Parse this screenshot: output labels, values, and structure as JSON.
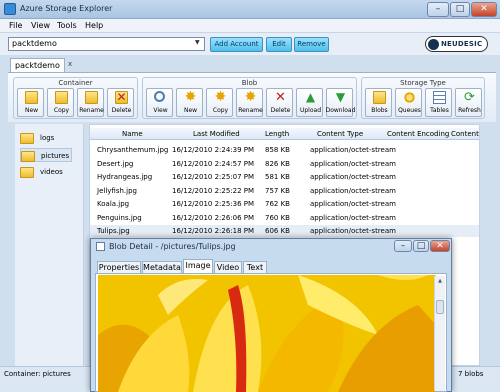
{
  "window": {
    "title": "Azure Storage Explorer"
  },
  "menubar": {
    "items": [
      "File",
      "View",
      "Tools",
      "Help"
    ]
  },
  "account": {
    "selected": "packtdemo",
    "buttons": {
      "add": "Add Account",
      "edit": "Edit",
      "remove": "Remove"
    }
  },
  "logo": {
    "text": "NEUDESIC"
  },
  "tabs": {
    "active": "packtdemo",
    "close": "x"
  },
  "toolbar": {
    "container": {
      "title": "Container",
      "buttons": [
        "New",
        "Copy",
        "Rename",
        "Delete"
      ]
    },
    "blob": {
      "title": "Blob",
      "buttons": [
        "View",
        "New",
        "Copy",
        "Rename",
        "Delete",
        "Upload",
        "Download"
      ]
    },
    "storage_type": {
      "title": "Storage Type",
      "buttons": [
        "Blobs",
        "Queues",
        "Tables",
        "Refresh"
      ]
    }
  },
  "containers": [
    "logs",
    "pictures",
    "videos"
  ],
  "table": {
    "headers": [
      "Name",
      "Last Modified",
      "Length",
      "Content Type",
      "Content Encoding",
      "Content"
    ],
    "rows": [
      [
        "Chrysanthemum.jpg",
        "16/12/2010 2:24:39 PM",
        "858 KB",
        "application/octet-stream"
      ],
      [
        "Desert.jpg",
        "16/12/2010 2:24:57 PM",
        "826 KB",
        "application/octet-stream"
      ],
      [
        "Hydrangeas.jpg",
        "16/12/2010 2:25:07 PM",
        "581 KB",
        "application/octet-stream"
      ],
      [
        "Jellyfish.jpg",
        "16/12/2010 2:25:22 PM",
        "757 KB",
        "application/octet-stream"
      ],
      [
        "Koala.jpg",
        "16/12/2010 2:25:36 PM",
        "762 KB",
        "application/octet-stream"
      ],
      [
        "Penguins.jpg",
        "16/12/2010 2:26:06 PM",
        "760 KB",
        "application/octet-stream"
      ],
      [
        "Tulips.jpg",
        "16/12/2010 2:26:18 PM",
        "606 KB",
        "application/octet-stream"
      ]
    ]
  },
  "status": {
    "left": "Container: pictures",
    "right": "7 blobs"
  },
  "detail": {
    "title": "Blob Detail - /pictures/Tulips.jpg",
    "tabs": [
      "Properties",
      "Metadata",
      "Image",
      "Video",
      "Text"
    ],
    "active_tab": "Image"
  }
}
